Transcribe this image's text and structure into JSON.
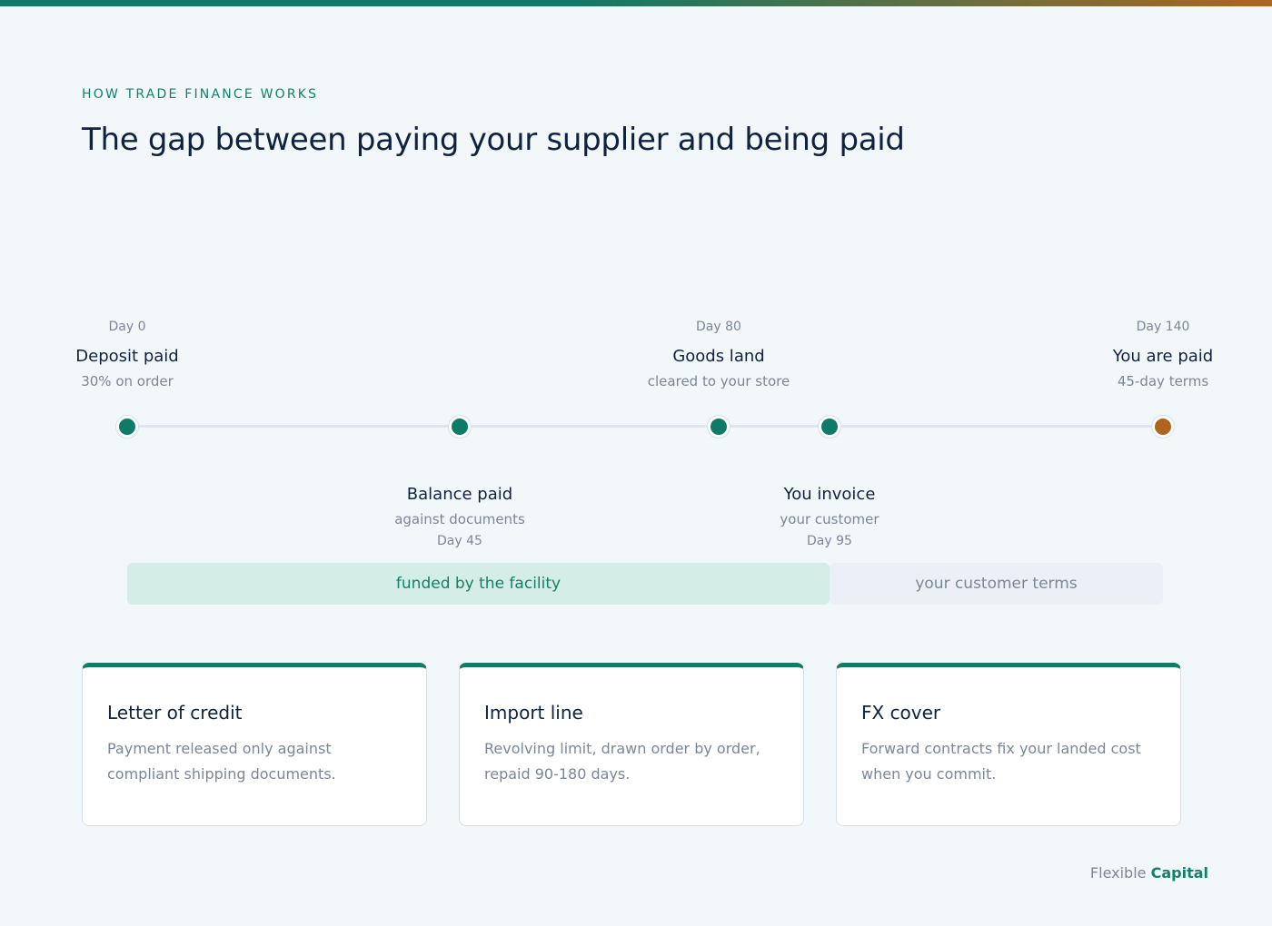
{
  "header": {
    "eyebrow": "HOW TRADE FINANCE WORKS",
    "title": "The gap between paying your supplier and being paid"
  },
  "timeline": {
    "milestones": [
      {
        "day": "Day 0",
        "label": "Deposit paid",
        "sub": "30% on order",
        "side": "above",
        "day_value": 0,
        "color": "#0e7a68"
      },
      {
        "day": "Day 45",
        "label": "Balance paid",
        "sub": "against documents",
        "side": "below",
        "day_value": 45,
        "color": "#0e7a68"
      },
      {
        "day": "Day 80",
        "label": "Goods land",
        "sub": "cleared to your store",
        "side": "above",
        "day_value": 80,
        "color": "#0e7a68"
      },
      {
        "day": "Day 95",
        "label": "You invoice",
        "sub": "your customer",
        "side": "below",
        "day_value": 95,
        "color": "#0e7a68"
      },
      {
        "day": "Day 140",
        "label": "You are paid",
        "sub": "45-day terms",
        "side": "above",
        "day_value": 140,
        "color": "#b0651e"
      }
    ],
    "bands": {
      "funded": "funded by the facility",
      "terms": "your customer terms"
    }
  },
  "cards": [
    {
      "title": "Letter of credit",
      "body": "Payment released only against compliant shipping documents."
    },
    {
      "title": "Import line",
      "body": "Revolving limit, drawn order by order, repaid 90-180 days."
    },
    {
      "title": "FX cover",
      "body": "Forward contracts fix your landed cost when you commit."
    }
  ],
  "brand": {
    "part1": "Flexible",
    "part2": "Capital"
  },
  "colors": {
    "accent": "#0e7a68",
    "end": "#b0651e"
  }
}
